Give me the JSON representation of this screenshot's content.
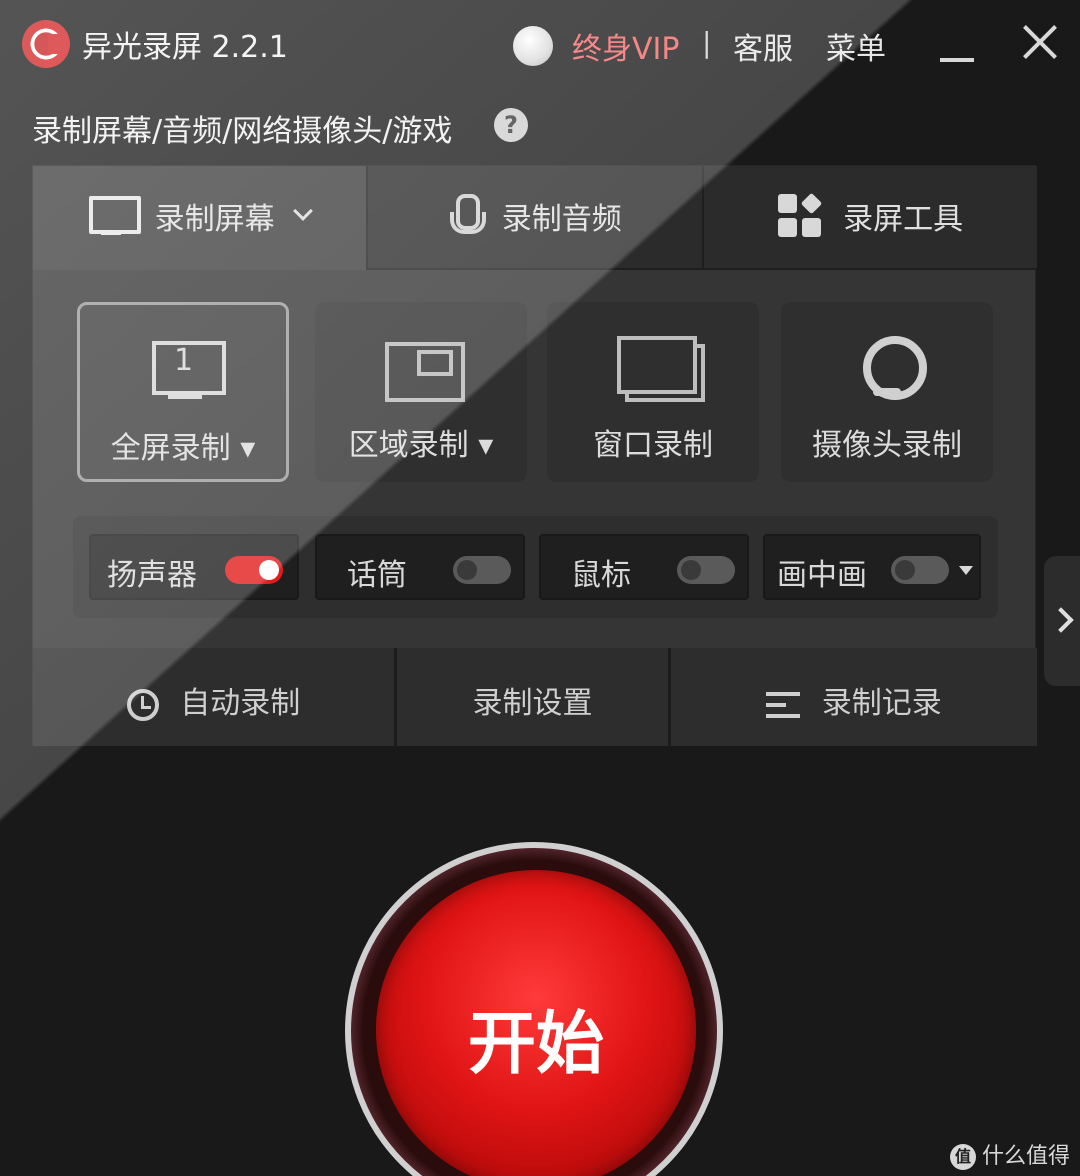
{
  "titlebar": {
    "app_name": "异光录屏 2.2.1",
    "vip_label": "终身VIP",
    "separator": "|",
    "service_label": "客服",
    "menu_label": "菜单"
  },
  "subtitle": "录制屏幕/音频/网络摄像头/游戏",
  "help_glyph": "?",
  "tabs": [
    {
      "label": "录制屏幕",
      "icon": "monitor-icon",
      "active": true
    },
    {
      "label": "录制音频",
      "icon": "microphone-icon",
      "active": false
    },
    {
      "label": "录屏工具",
      "icon": "tools-grid-icon",
      "active": false
    }
  ],
  "modes": [
    {
      "label": "全屏录制 ▾",
      "icon": "fullscreen-monitor-icon",
      "monitor_number": "1",
      "active": true
    },
    {
      "label": "区域录制 ▾",
      "icon": "region-icon",
      "active": false
    },
    {
      "label": "窗口录制",
      "icon": "window-icon",
      "active": false
    },
    {
      "label": "摄像头录制",
      "icon": "webcam-icon",
      "active": false
    }
  ],
  "toggles": [
    {
      "label": "扬声器",
      "on": true
    },
    {
      "label": "话筒",
      "on": false
    },
    {
      "label": "鼠标",
      "on": false
    },
    {
      "label": "画中画",
      "on": false
    }
  ],
  "bottom_bar": {
    "auto_record": "自动录制",
    "settings": "录制设置",
    "history": "录制记录"
  },
  "start_button": "开始",
  "watermark": {
    "logo_glyph": "值",
    "text": "什么值得买"
  },
  "colors": {
    "accent_red": "#e21b1b",
    "vip_pink": "#f26767",
    "background": "#191919"
  }
}
